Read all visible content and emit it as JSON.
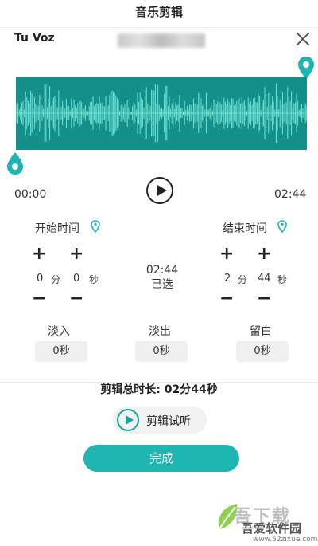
{
  "header": {
    "title": "音乐剪辑"
  },
  "song": {
    "title": "Tu Voz"
  },
  "colors": {
    "accent": "#1fb6b2",
    "waveform_bg": "#14908b",
    "waveform_line": "#6fe3d3"
  },
  "player": {
    "start_time": "00:00",
    "end_time": "02:44"
  },
  "start": {
    "label": "开始时间",
    "minutes": "0",
    "minutes_unit": "分",
    "seconds": "0",
    "seconds_unit": "秒"
  },
  "end": {
    "label": "结束时间",
    "minutes": "2",
    "minutes_unit": "分",
    "seconds": "44",
    "seconds_unit": "秒"
  },
  "selection": {
    "duration": "02:44",
    "label": "已选"
  },
  "controls": {
    "plus": "+",
    "minus": "−"
  },
  "effects": [
    {
      "label": "淡入",
      "value": "0秒"
    },
    {
      "label": "淡出",
      "value": "0秒"
    },
    {
      "label": "留白",
      "value": "0秒"
    }
  ],
  "total": {
    "text": "剪辑总时长: 02分44秒"
  },
  "preview": {
    "label": "剪辑试听"
  },
  "done": {
    "label": "完成"
  },
  "watermark": {
    "title": "吾下载",
    "site_name": "吾爱软件园",
    "url": "www.52zixue.com"
  }
}
